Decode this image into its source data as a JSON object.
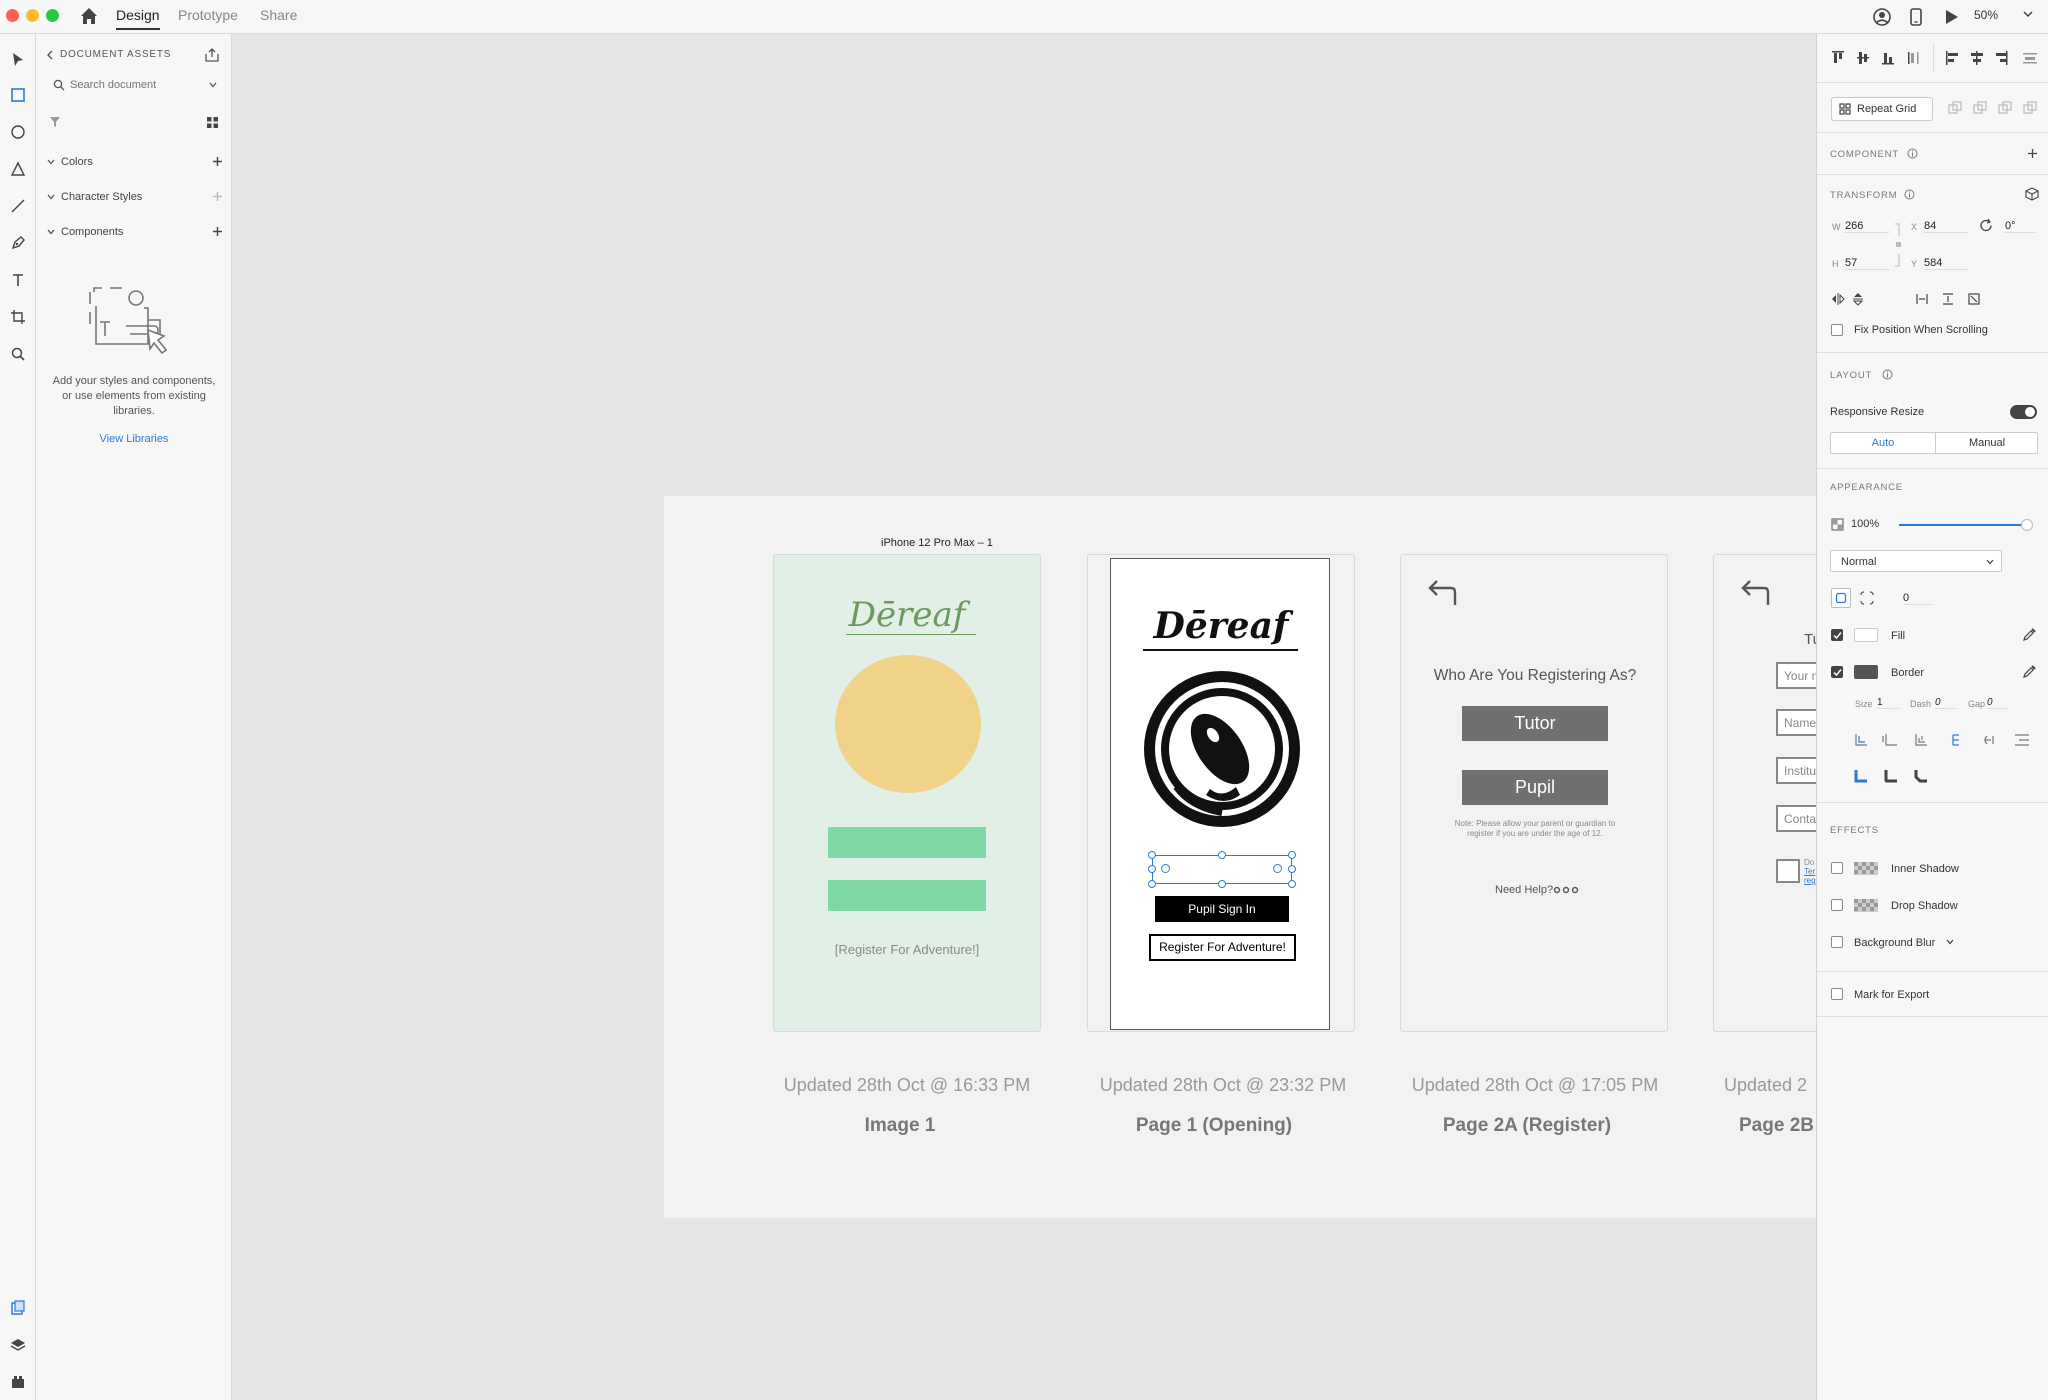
{
  "titlebar": {
    "tabs": [
      "Design",
      "Prototype",
      "Share"
    ],
    "zoom": "50%"
  },
  "assets": {
    "heading": "DOCUMENT ASSETS",
    "search_placeholder": "Search document",
    "sections": [
      "Colors",
      "Character Styles",
      "Components"
    ],
    "empty_text": "Add your styles and components, or use elements from existing libraries.",
    "view_libraries": "View Libraries"
  },
  "canvas": {
    "selected_artboard_title": "iPhone 12 Pro Max – 1",
    "artboards": [
      {
        "updated": "Updated 28th Oct @ 16:33 PM",
        "name": "Image 1"
      },
      {
        "updated": "Updated 28th Oct @ 23:32 PM",
        "name": "Page 1 (Opening)"
      },
      {
        "updated": "Updated 28th Oct @ 17:05 PM",
        "name": "Page 2A (Register)"
      },
      {
        "updated": "Updated 2",
        "name": "Page 2B"
      }
    ],
    "image1": {
      "logo": "Dēreaf",
      "link": "[Register For Adventure!]"
    },
    "page1": {
      "logo": "Dēreaf",
      "sign_in": "Pupil Sign In",
      "register": "Register For Adventure!"
    },
    "page2a": {
      "question": "Who Are You Registering As?",
      "tutor": "Tutor",
      "pupil": "Pupil",
      "note": "Note: Please allow your parent or guardian to register if you are under the age of 12.",
      "help": "Need Help?"
    },
    "page2b": {
      "title_partial": "Tu",
      "fields": [
        "Your n",
        "Name",
        "Institu",
        "Conta"
      ],
      "small": [
        "Do",
        "Ter",
        "reg"
      ]
    }
  },
  "inspector": {
    "repeat_grid": "Repeat Grid",
    "component": "COMPONENT",
    "transform": "TRANSFORM",
    "w_label": "W",
    "w": "266",
    "h_label": "H",
    "h": "57",
    "x_label": "X",
    "x": "84",
    "y_label": "Y",
    "y": "584",
    "rotation": "0°",
    "fix_position": "Fix Position When Scrolling",
    "layout": "LAYOUT",
    "responsive_resize": "Responsive Resize",
    "auto": "Auto",
    "manual": "Manual",
    "appearance": "APPEARANCE",
    "opacity": "100%",
    "opacity_fraction": 1.0,
    "blend_mode": "Normal",
    "corner_radius": "0",
    "fill": "Fill",
    "border": "Border",
    "size_label": "Size",
    "size": "1",
    "dash_label": "Dash",
    "dash": "0",
    "gap_label": "Gap",
    "gap": "0",
    "effects": "EFFECTS",
    "inner_shadow": "Inner Shadow",
    "drop_shadow": "Drop Shadow",
    "background_blur": "Background Blur",
    "mark_export": "Mark for Export"
  },
  "colors": {
    "accent": "#2d7ad6",
    "image1_bg": "#e1efe7",
    "circle": "#f0d389",
    "bar": "#7fd9a4",
    "logo_green": "#6a9a5c",
    "gray_button": "#707070"
  }
}
